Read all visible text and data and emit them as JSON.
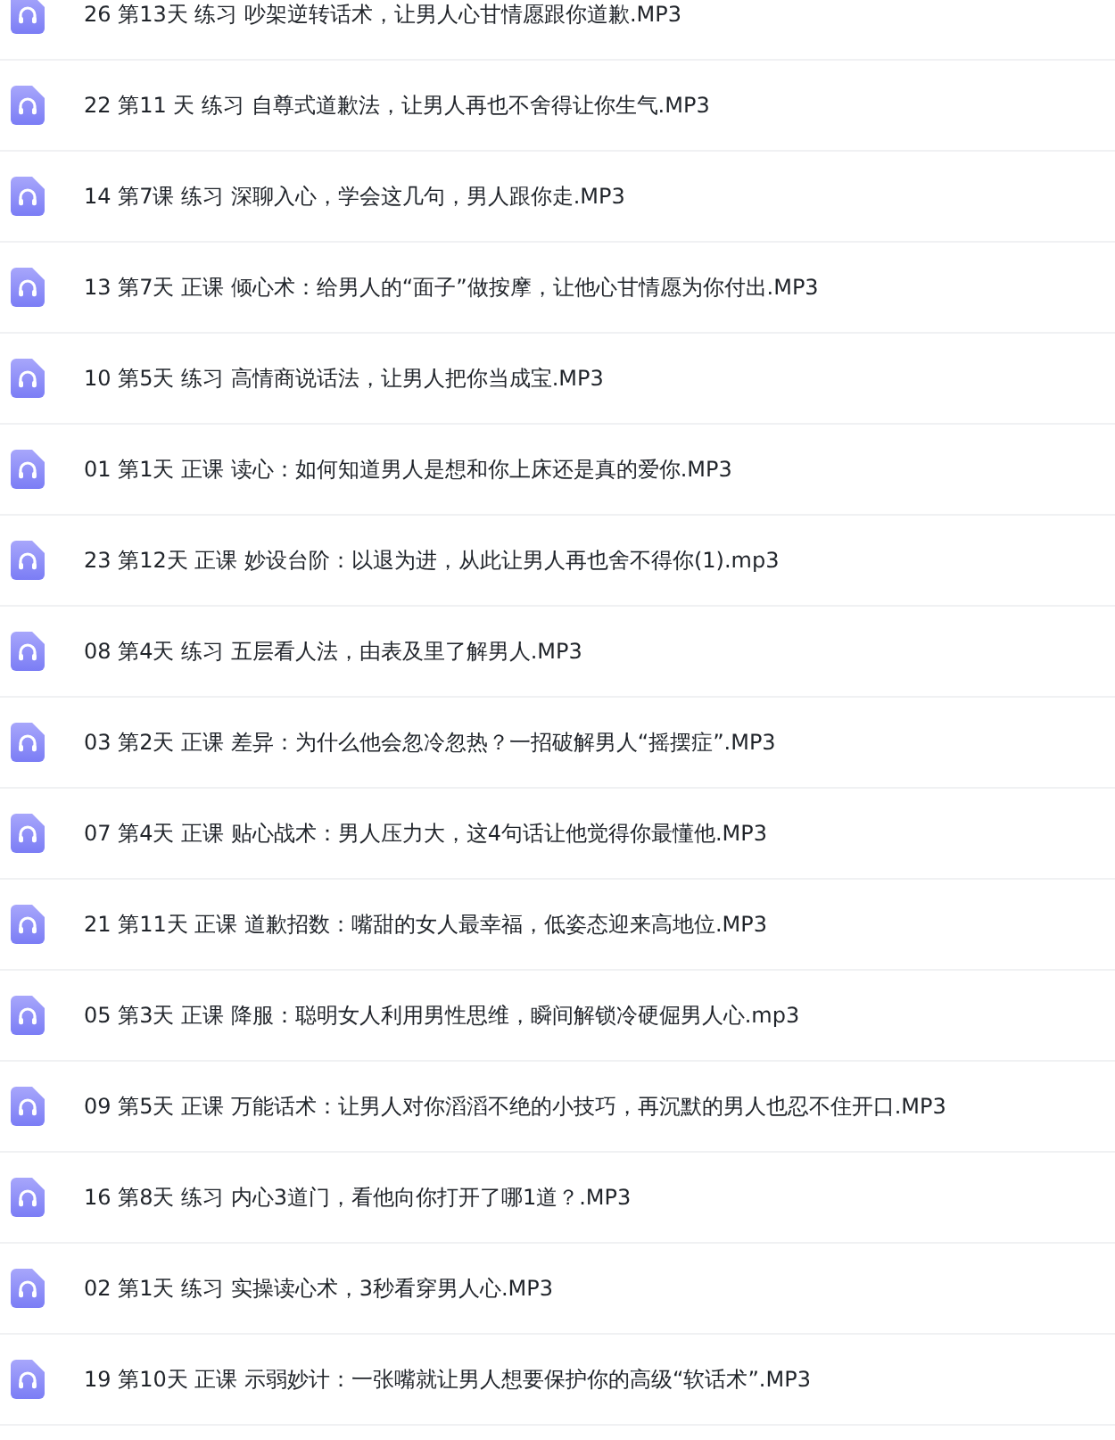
{
  "files": [
    {
      "name": "26 第13天 练习 吵架逆转话术，让男人心甘情愿跟你道歉.MP3"
    },
    {
      "name": "22 第11 天 练习 自尊式道歉法，让男人再也不舍得让你生气.MP3"
    },
    {
      "name": "14 第7课 练习 深聊入心，学会这几句，男人跟你走.MP3"
    },
    {
      "name": "13 第7天 正课 倾心术：给男人的“面子”做按摩，让他心甘情愿为你付出.MP3"
    },
    {
      "name": "10 第5天 练习 高情商说话法，让男人把你当成宝.MP3"
    },
    {
      "name": "01 第1天 正课 读心：如何知道男人是想和你上床还是真的爱你.MP3"
    },
    {
      "name": "23 第12天 正课 妙设台阶：以退为进，从此让男人再也舍不得你(1).mp3"
    },
    {
      "name": "08 第4天 练习 五层看人法，由表及里了解男人.MP3"
    },
    {
      "name": "03 第2天 正课 差异：为什么他会忽冷忽热？一招破解男人“摇摆症”.MP3"
    },
    {
      "name": "07 第4天 正课 贴心战术：男人压力大，这4句话让他觉得你最懂他.MP3"
    },
    {
      "name": "21 第11天 正课 道歉招数：嘴甜的女人最幸福，低姿态迎来高地位.MP3"
    },
    {
      "name": "05 第3天 正课 降服：聪明女人利用男性思维，瞬间解锁冷硬倔男人心.mp3"
    },
    {
      "name": "09 第5天 正课 万能话术：让男人对你滔滔不绝的小技巧，再沉默的男人也忍不住开口.MP3"
    },
    {
      "name": "16 第8天 练习 内心3道门，看他向你打开了哪1道？.MP3"
    },
    {
      "name": "02 第1天 练习 实操读心术，3秒看穿男人心.MP3"
    },
    {
      "name": "19 第10天 正课 示弱妙计：一张嘴就让男人想要保护你的高级“软话术”.MP3"
    }
  ]
}
